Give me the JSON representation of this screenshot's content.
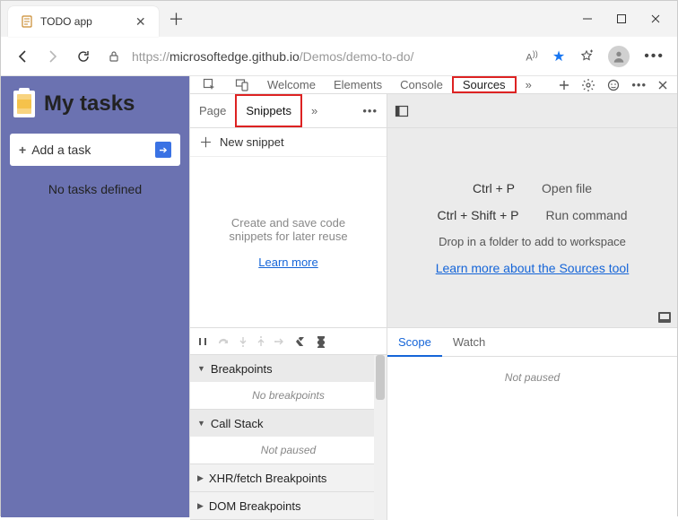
{
  "window": {
    "title": "TODO app"
  },
  "address": {
    "protocol": "https://",
    "host": "microsoftedge.github.io",
    "path": "/Demos/demo-to-do/"
  },
  "page": {
    "heading": "My tasks",
    "add_task_label": "Add a task",
    "add_task_placeholder": "+",
    "empty": "No tasks defined"
  },
  "devtools": {
    "tabs": {
      "welcome": "Welcome",
      "elements": "Elements",
      "console": "Console",
      "sources": "Sources"
    },
    "nav": {
      "page_tab": "Page",
      "snippets_tab": "Snippets",
      "new_snippet": "New snippet",
      "empty_msg": "Create and save code snippets for later reuse",
      "learn": "Learn more"
    },
    "editor": {
      "open_file_kbd": "Ctrl + P",
      "open_file_lbl": "Open file",
      "run_cmd_kbd": "Ctrl + Shift + P",
      "run_cmd_lbl": "Run command",
      "drop": "Drop in a folder to add to workspace",
      "learn": "Learn more about the Sources tool"
    },
    "debugger": {
      "breakpoints": "Breakpoints",
      "no_bp": "No breakpoints",
      "callstack": "Call Stack",
      "not_paused": "Not paused",
      "xhr": "XHR/fetch Breakpoints",
      "dom": "DOM Breakpoints"
    },
    "scope": {
      "scope_tab": "Scope",
      "watch_tab": "Watch",
      "not_paused": "Not paused"
    }
  }
}
